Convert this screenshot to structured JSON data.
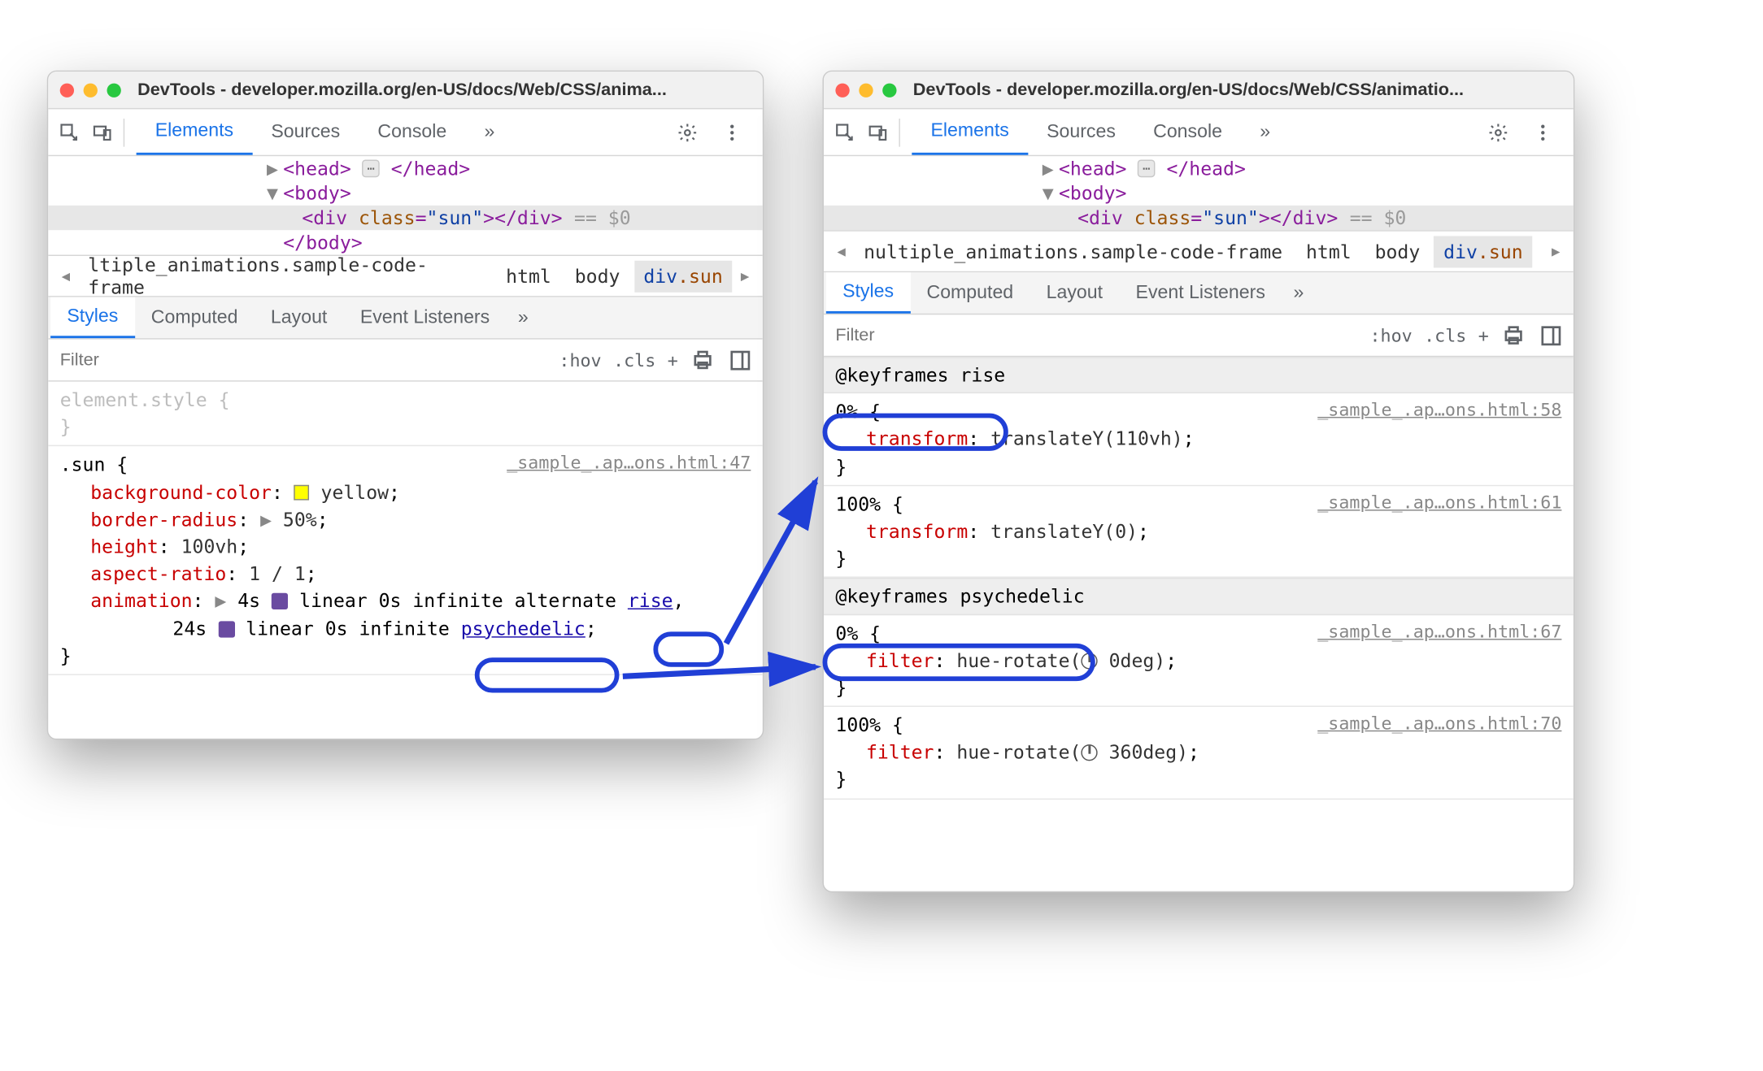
{
  "left": {
    "title": "DevTools - developer.mozilla.org/en-US/docs/Web/CSS/anima...",
    "tabs": {
      "elements": "Elements",
      "sources": "Sources",
      "console": "Console",
      "more": "»"
    },
    "dom": {
      "head_open": "<head>",
      "head_close": "</head>",
      "body_open": "<body>",
      "body_close": "</body>",
      "div_open_tag": "div",
      "cls_attr": "class",
      "cls_val": "\"sun\"",
      "div_close": "</div>",
      "eqzero": "== $0"
    },
    "breadcrumb": {
      "first": "ltiple_animations.",
      "frame": "sample-code-frame",
      "html": "html",
      "body": "body",
      "sel_el": "div",
      "sel_cls": ".sun"
    },
    "subtabs": {
      "styles": "Styles",
      "computed": "Computed",
      "layout": "Layout",
      "evl": "Event Listeners",
      "more": "»"
    },
    "filter": {
      "placeholder": "Filter",
      "hov": ":hov",
      "cls": ".cls",
      "plus": "+"
    },
    "styles": {
      "elstyle_sel": "element.style {",
      "sun": {
        "src": "_sample_.ap…ons.html:47",
        "sel": ".sun {",
        "bg_name": "background-color",
        "bg_val": "yellow",
        "br_name": "border-radius",
        "br_val": "50%",
        "h_name": "height",
        "h_val": "100vh",
        "ar_name": "aspect-ratio",
        "ar_val": "1 / 1",
        "an_name": "animation",
        "an_l1_pre": "4s ",
        "an_l1_mid": "linear 0s infinite alternate ",
        "an_l1_link": "rise",
        "an_l2_pre": "24s ",
        "an_l2_mid": "linear 0s infinite ",
        "an_l2_link": "psychedelic"
      },
      "close": "}"
    }
  },
  "right": {
    "title": "DevTools - developer.mozilla.org/en-US/docs/Web/CSS/animatio...",
    "tabs": {
      "elements": "Elements",
      "sources": "Sources",
      "console": "Console",
      "more": "»"
    },
    "dom": {
      "head_open": "<head>",
      "head_close": "</head>",
      "body_open": "<body>",
      "body_close": "</body>",
      "div_open_tag": "div",
      "cls_attr": "class",
      "cls_val": "\"sun\"",
      "div_close": "</div>",
      "eqzero": "== $0"
    },
    "breadcrumb": {
      "first": "nultiple_animations.",
      "frame": "sample-code-frame",
      "html": "html",
      "body": "body",
      "sel_el": "div",
      "sel_cls": ".sun"
    },
    "subtabs": {
      "styles": "Styles",
      "computed": "Computed",
      "layout": "Layout",
      "evl": "Event Listeners",
      "more": "»"
    },
    "filter": {
      "placeholder": "Filter",
      "hov": ":hov",
      "cls": ".cls",
      "plus": "+"
    },
    "kf": {
      "rise": {
        "header": "@keyframes rise",
        "p0": {
          "src": "_sample_.ap…ons.html:58",
          "sel": "0% {",
          "prop": "transform",
          "val": "translateY(110vh)",
          "close": "}"
        },
        "p100": {
          "src": "_sample_.ap…ons.html:61",
          "sel": "100% {",
          "prop": "transform",
          "val": "translateY(0)",
          "close": "}"
        }
      },
      "psy": {
        "header": "@keyframes psychedelic",
        "p0": {
          "src": "_sample_.ap…ons.html:67",
          "sel": "0% {",
          "prop": "filter",
          "val_pre": "hue-rotate(",
          "val_num": "0deg",
          "val_post": ")",
          "close": "}"
        },
        "p100": {
          "src": "_sample_.ap…ons.html:70",
          "sel": "100% {",
          "prop": "filter",
          "val_pre": "hue-rotate(",
          "val_num": "360deg",
          "val_post": ")",
          "close": "}"
        }
      }
    }
  }
}
